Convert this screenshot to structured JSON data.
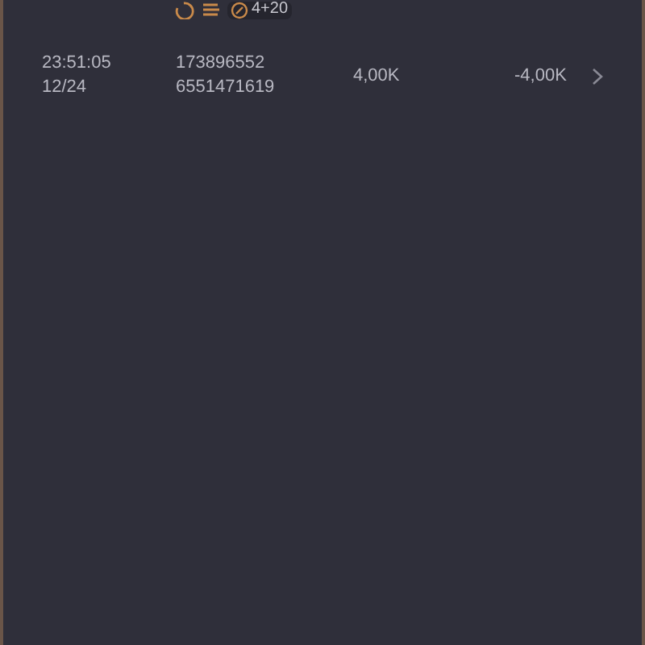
{
  "top_badges": {
    "count": "4+20"
  },
  "rows": [
    {
      "time": "23:51:05",
      "date": "12/24",
      "id_1": "173896552",
      "id_2": "6551471619",
      "amount": "4,00K",
      "result": "-4,00K"
    }
  ]
}
